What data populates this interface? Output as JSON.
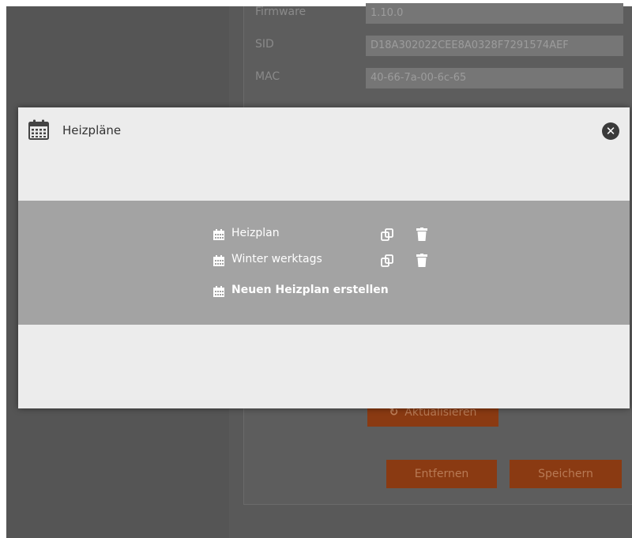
{
  "device": {
    "rows": [
      {
        "label": "Firmware",
        "value": "1.10.0"
      },
      {
        "label": "SID",
        "value": "D18A302022CEE8A0328F7291574AEF"
      },
      {
        "label": "MAC",
        "value": "40-66-7a-00-6c-65"
      }
    ],
    "refresh_label": "Aktualisieren",
    "remove_label": "Entfernen",
    "save_label": "Speichern"
  },
  "modal": {
    "title": "Heizpläne",
    "title_icon": "calendar-icon",
    "close_icon": "close-icon"
  },
  "plans": [
    {
      "name": "Heizplan"
    },
    {
      "name": "Winter werktags"
    }
  ],
  "create_label": "Neuen Heizplan erstellen",
  "colors": {
    "accent": "#8a3a12",
    "band": "#a3a3a3",
    "modal_bg": "#ececec"
  }
}
